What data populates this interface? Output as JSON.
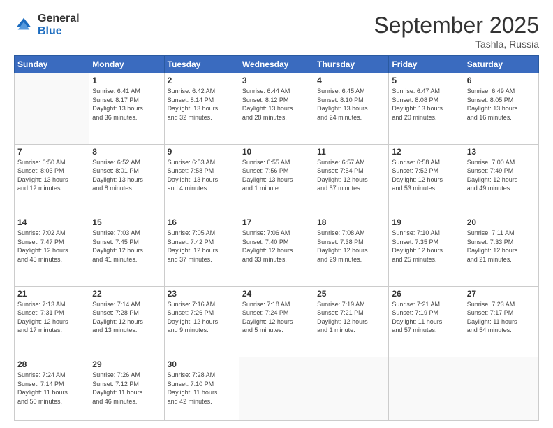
{
  "logo": {
    "general": "General",
    "blue": "Blue"
  },
  "header": {
    "month": "September 2025",
    "location": "Tashla, Russia"
  },
  "weekdays": [
    "Sunday",
    "Monday",
    "Tuesday",
    "Wednesday",
    "Thursday",
    "Friday",
    "Saturday"
  ],
  "weeks": [
    [
      {
        "day": "",
        "info": ""
      },
      {
        "day": "1",
        "info": "Sunrise: 6:41 AM\nSunset: 8:17 PM\nDaylight: 13 hours\nand 36 minutes."
      },
      {
        "day": "2",
        "info": "Sunrise: 6:42 AM\nSunset: 8:14 PM\nDaylight: 13 hours\nand 32 minutes."
      },
      {
        "day": "3",
        "info": "Sunrise: 6:44 AM\nSunset: 8:12 PM\nDaylight: 13 hours\nand 28 minutes."
      },
      {
        "day": "4",
        "info": "Sunrise: 6:45 AM\nSunset: 8:10 PM\nDaylight: 13 hours\nand 24 minutes."
      },
      {
        "day": "5",
        "info": "Sunrise: 6:47 AM\nSunset: 8:08 PM\nDaylight: 13 hours\nand 20 minutes."
      },
      {
        "day": "6",
        "info": "Sunrise: 6:49 AM\nSunset: 8:05 PM\nDaylight: 13 hours\nand 16 minutes."
      }
    ],
    [
      {
        "day": "7",
        "info": "Sunrise: 6:50 AM\nSunset: 8:03 PM\nDaylight: 13 hours\nand 12 minutes."
      },
      {
        "day": "8",
        "info": "Sunrise: 6:52 AM\nSunset: 8:01 PM\nDaylight: 13 hours\nand 8 minutes."
      },
      {
        "day": "9",
        "info": "Sunrise: 6:53 AM\nSunset: 7:58 PM\nDaylight: 13 hours\nand 4 minutes."
      },
      {
        "day": "10",
        "info": "Sunrise: 6:55 AM\nSunset: 7:56 PM\nDaylight: 13 hours\nand 1 minute."
      },
      {
        "day": "11",
        "info": "Sunrise: 6:57 AM\nSunset: 7:54 PM\nDaylight: 12 hours\nand 57 minutes."
      },
      {
        "day": "12",
        "info": "Sunrise: 6:58 AM\nSunset: 7:52 PM\nDaylight: 12 hours\nand 53 minutes."
      },
      {
        "day": "13",
        "info": "Sunrise: 7:00 AM\nSunset: 7:49 PM\nDaylight: 12 hours\nand 49 minutes."
      }
    ],
    [
      {
        "day": "14",
        "info": "Sunrise: 7:02 AM\nSunset: 7:47 PM\nDaylight: 12 hours\nand 45 minutes."
      },
      {
        "day": "15",
        "info": "Sunrise: 7:03 AM\nSunset: 7:45 PM\nDaylight: 12 hours\nand 41 minutes."
      },
      {
        "day": "16",
        "info": "Sunrise: 7:05 AM\nSunset: 7:42 PM\nDaylight: 12 hours\nand 37 minutes."
      },
      {
        "day": "17",
        "info": "Sunrise: 7:06 AM\nSunset: 7:40 PM\nDaylight: 12 hours\nand 33 minutes."
      },
      {
        "day": "18",
        "info": "Sunrise: 7:08 AM\nSunset: 7:38 PM\nDaylight: 12 hours\nand 29 minutes."
      },
      {
        "day": "19",
        "info": "Sunrise: 7:10 AM\nSunset: 7:35 PM\nDaylight: 12 hours\nand 25 minutes."
      },
      {
        "day": "20",
        "info": "Sunrise: 7:11 AM\nSunset: 7:33 PM\nDaylight: 12 hours\nand 21 minutes."
      }
    ],
    [
      {
        "day": "21",
        "info": "Sunrise: 7:13 AM\nSunset: 7:31 PM\nDaylight: 12 hours\nand 17 minutes."
      },
      {
        "day": "22",
        "info": "Sunrise: 7:14 AM\nSunset: 7:28 PM\nDaylight: 12 hours\nand 13 minutes."
      },
      {
        "day": "23",
        "info": "Sunrise: 7:16 AM\nSunset: 7:26 PM\nDaylight: 12 hours\nand 9 minutes."
      },
      {
        "day": "24",
        "info": "Sunrise: 7:18 AM\nSunset: 7:24 PM\nDaylight: 12 hours\nand 5 minutes."
      },
      {
        "day": "25",
        "info": "Sunrise: 7:19 AM\nSunset: 7:21 PM\nDaylight: 12 hours\nand 1 minute."
      },
      {
        "day": "26",
        "info": "Sunrise: 7:21 AM\nSunset: 7:19 PM\nDaylight: 11 hours\nand 57 minutes."
      },
      {
        "day": "27",
        "info": "Sunrise: 7:23 AM\nSunset: 7:17 PM\nDaylight: 11 hours\nand 54 minutes."
      }
    ],
    [
      {
        "day": "28",
        "info": "Sunrise: 7:24 AM\nSunset: 7:14 PM\nDaylight: 11 hours\nand 50 minutes."
      },
      {
        "day": "29",
        "info": "Sunrise: 7:26 AM\nSunset: 7:12 PM\nDaylight: 11 hours\nand 46 minutes."
      },
      {
        "day": "30",
        "info": "Sunrise: 7:28 AM\nSunset: 7:10 PM\nDaylight: 11 hours\nand 42 minutes."
      },
      {
        "day": "",
        "info": ""
      },
      {
        "day": "",
        "info": ""
      },
      {
        "day": "",
        "info": ""
      },
      {
        "day": "",
        "info": ""
      }
    ]
  ]
}
